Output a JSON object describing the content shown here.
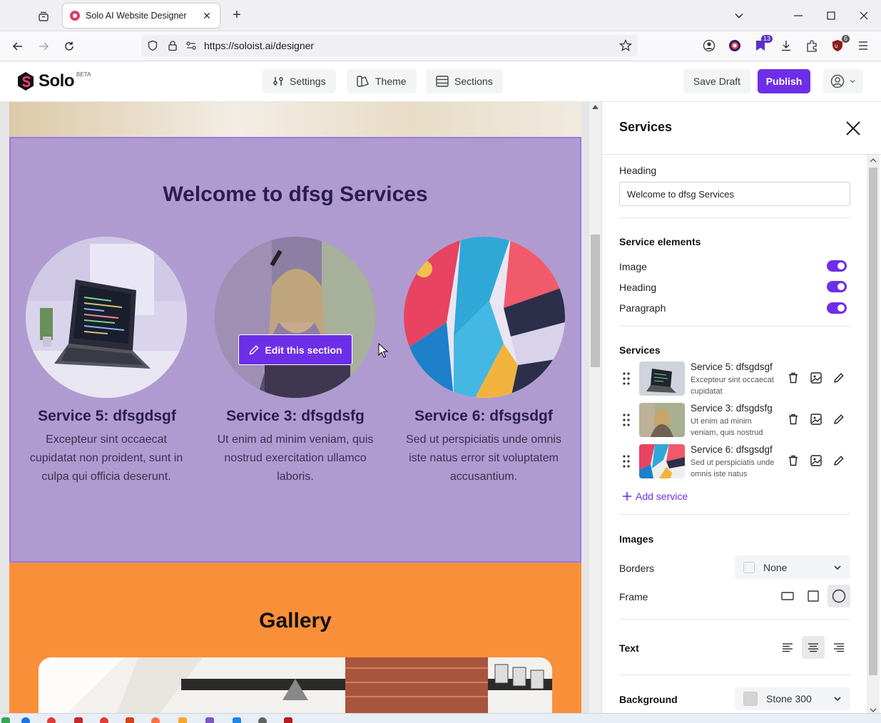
{
  "browser": {
    "tab_title": "Solo AI Website Designer",
    "url": "https://soloist.ai/designer",
    "badges": {
      "ext1": "13",
      "ext2": "6"
    }
  },
  "app": {
    "logo_name": "Solo",
    "logo_badge": "BETA",
    "nav": {
      "settings": "Settings",
      "theme": "Theme",
      "sections": "Sections"
    },
    "save_draft": "Save Draft",
    "publish": "Publish"
  },
  "canvas": {
    "services_heading": "Welcome to dfsg Services",
    "edit_button": "Edit this section",
    "services": [
      {
        "title": "Service 5: dfsgdsgf",
        "text": "Excepteur sint occaecat cupidatat non proident, sunt in culpa qui officia deserunt."
      },
      {
        "title": "Service 3: dfsgdsfg",
        "text": "Ut enim ad minim veniam, quis nostrud exercitation ullamco laboris."
      },
      {
        "title": "Service 6: dfsgsdgf",
        "text": "Sed ut perspiciatis unde omnis iste natus error sit voluptatem accusantium."
      }
    ],
    "gallery_heading": "Gallery"
  },
  "panel": {
    "title": "Services",
    "heading_label": "Heading",
    "heading_value": "Welcome to dfsg Services",
    "service_elements_label": "Service elements",
    "toggles": [
      {
        "label": "Image",
        "on": true
      },
      {
        "label": "Heading",
        "on": true
      },
      {
        "label": "Paragraph",
        "on": true
      }
    ],
    "services_label": "Services",
    "service_items": [
      {
        "name": "Service 5: dfsgdsgf",
        "desc": "Excepteur sint occaecat cupidatat"
      },
      {
        "name": "Service 3: dfsgdsfg",
        "desc": "Ut enim ad minim veniam, quis nostrud"
      },
      {
        "name": "Service 6: dfsgsdgf",
        "desc": "Sed ut perspiciatis unde omnis iste natus"
      }
    ],
    "add_service": "Add service",
    "images_label": "Images",
    "borders_label": "Borders",
    "borders_value": "None",
    "frame_label": "Frame",
    "text_label": "Text",
    "background_label": "Background",
    "background_value": "Stone 300"
  },
  "colors": {
    "accent": "#6d2ee8",
    "services_bg": "#af9bd0",
    "gallery_bg": "#fa8f3a",
    "stone_300": "#d6d3d1"
  }
}
